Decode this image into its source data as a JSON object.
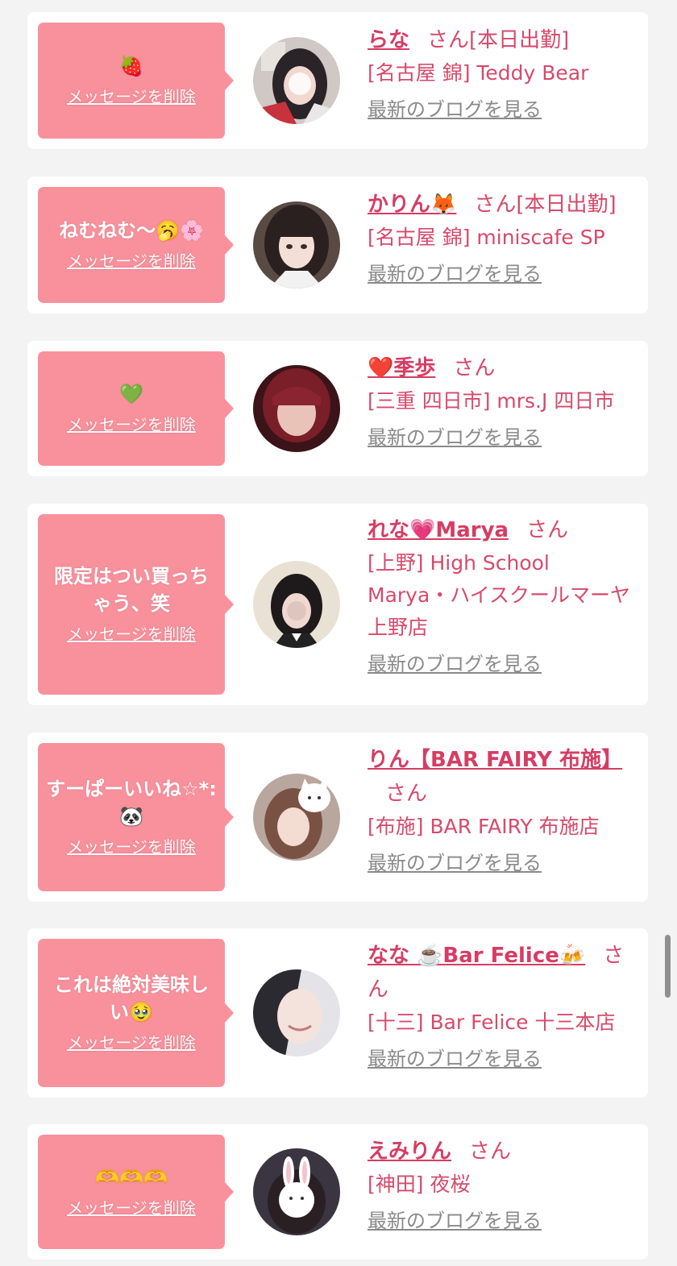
{
  "common": {
    "delete_label": "メッセージを削除",
    "blog_label": "最新のブログを見る",
    "san": "さん"
  },
  "colors": {
    "bubble": "#f9919d",
    "accent_text": "#d64a6b",
    "link_gray": "#8a8a8a",
    "card_bg": "#ffffff",
    "page_bg": "#f3f3f3"
  },
  "items": [
    {
      "message": "🍓",
      "name": "らな",
      "tag": "[本日出勤]",
      "shop": "[名古屋 錦] Teddy Bear",
      "avatar_icon": "avatar-photo-icon"
    },
    {
      "message": "ねむねむ〜🥱🌸",
      "name": "かりん🦊",
      "tag": "[本日出勤]",
      "shop": "[名古屋 錦] miniscafe SP",
      "avatar_icon": "avatar-photo-icon"
    },
    {
      "message": "💚",
      "name": "❤️季歩",
      "tag": "",
      "shop": "[三重 四日市] mrs.J 四日市",
      "avatar_icon": "avatar-photo-icon"
    },
    {
      "message": "限定はつい買っちゃう、笑",
      "name": "れな💗Marya",
      "tag": "",
      "shop": "[上野] High School Marya・ハイスクールマーヤ上野店",
      "avatar_icon": "avatar-photo-icon"
    },
    {
      "message": "すーぱーいいね☆*:🐼",
      "name": "りん【BAR FAIRY 布施】",
      "tag": "",
      "shop": "[布施] BAR FAIRY 布施店",
      "avatar_icon": "avatar-photo-icon"
    },
    {
      "message": "これは絶対美味しい🥹",
      "name": "なな ☕️Bar Felice🍻",
      "tag": "",
      "shop": "[十三] Bar Felice 十三本店",
      "avatar_icon": "avatar-photo-icon"
    },
    {
      "message": "🫶🫶🫶",
      "name": "えみりん",
      "tag": "",
      "shop": "[神田] 夜桜",
      "avatar_icon": "avatar-photo-icon"
    }
  ]
}
